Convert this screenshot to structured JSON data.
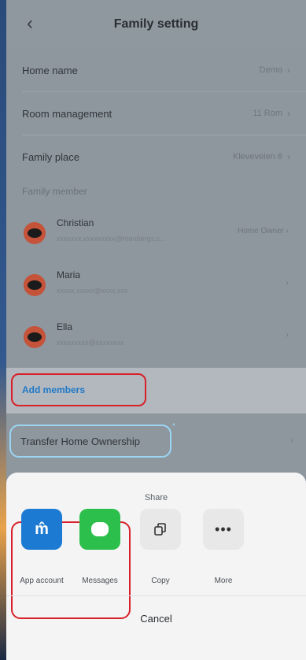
{
  "header": {
    "title": "Family setting"
  },
  "settings": [
    {
      "label": "Home name",
      "value": "Demo"
    },
    {
      "label": "Room management",
      "value": "11 Rom"
    },
    {
      "label": "Family place",
      "value": "Kleveveien 6"
    }
  ],
  "family_member_label": "Family member",
  "members": [
    {
      "name": "Christian",
      "email": "xxxxxxx.xxxxxxxxx@roenbergs.c...",
      "role": "Home Owner"
    },
    {
      "name": "Maria",
      "email": "xxxxx.xxxxx@xxxx.xxx",
      "role": ""
    },
    {
      "name": "Ella",
      "email": "xxxxxxxxx@xxxxxxxx",
      "role": ""
    }
  ],
  "actions": {
    "add_members": "Add members",
    "transfer": "Transfer Home Ownership"
  },
  "share": {
    "title": "Share",
    "options": [
      {
        "label": "App account",
        "icon": "app-account-icon"
      },
      {
        "label": "Messages",
        "icon": "messages-icon"
      },
      {
        "label": "Copy",
        "icon": "copy-icon"
      },
      {
        "label": "More",
        "icon": "more-icon"
      }
    ],
    "cancel": "Cancel"
  },
  "colors": {
    "highlight_red": "#d8202a",
    "highlight_blue": "#9ad6f4",
    "link_blue": "#1f78c8"
  }
}
